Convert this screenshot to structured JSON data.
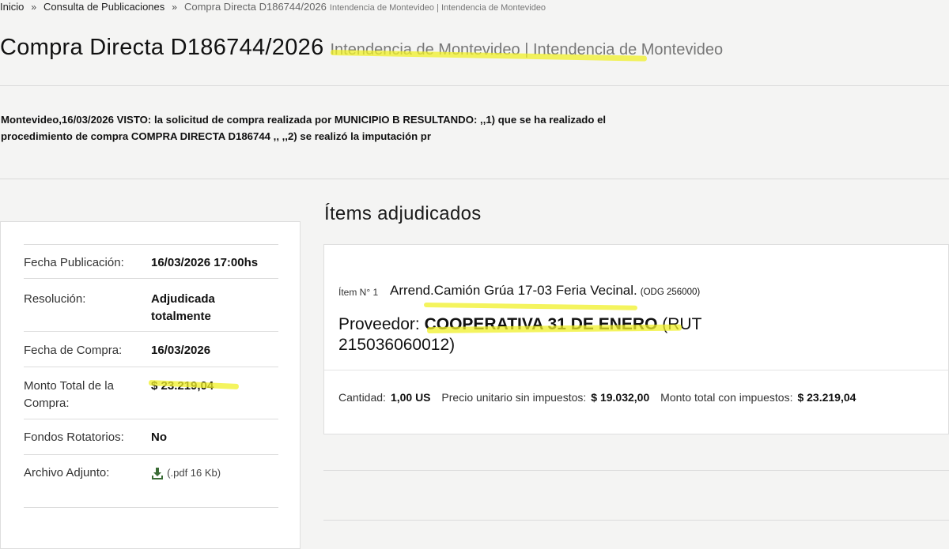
{
  "breadcrumb": {
    "items": [
      "Inicio",
      "Consulta de Publicaciones"
    ],
    "separator": "»",
    "current": "Compra Directa D186744/2026",
    "current_sub": "Intendencia de Montevideo | Intendencia de Montevideo"
  },
  "header": {
    "title": "Compra Directa D186744/2026",
    "subtitle": "Intendencia de Montevideo | Intendencia de Montevideo"
  },
  "description": {
    "line1": "Montevideo,16/03/2026 VISTO: la solicitud de compra realizada por MUNICIPIO B RESULTANDO: ,,1) que se ha realizado el",
    "line2": "procedimiento de compra COMPRA DIRECTA D186744 ,, ,,2) se realizó la imputación pr"
  },
  "details": {
    "fecha_publicacion": {
      "label": "Fecha Publicación:",
      "value": "16/03/2026 17:00hs"
    },
    "resolucion": {
      "label": "Resolución:",
      "value": "Adjudicada totalmente"
    },
    "fecha_compra": {
      "label": "Fecha de Compra:",
      "value": "16/03/2026"
    },
    "monto_total": {
      "label": "Monto Total de la Compra:",
      "value": "$ 23.219,04"
    },
    "fondos_rotatorios": {
      "label": "Fondos Rotatorios:",
      "value": "No"
    },
    "archivo_adjunto": {
      "label": "Archivo Adjunto:",
      "value": "(.pdf 16 Kb)",
      "icon": "download-icon"
    }
  },
  "items_section": {
    "heading": "Ítems adjudicados",
    "items": [
      {
        "number_label": "Ítem N° 1",
        "description": "Arrend.Camión Grúa 17-03 Feria Vecinal.",
        "odg": "(ODG 256000)",
        "supplier_label": "Proveedor:",
        "supplier_name": "COOPERATIVA 31 DE ENERO",
        "supplier_rut": "(RUT 215036060012)",
        "cantidad_label": "Cantidad:",
        "cantidad_value": "1,00 US",
        "precio_label": "Precio unitario sin impuestos:",
        "precio_value": "$ 19.032,00",
        "monto_label": "Monto total con impuestos:",
        "monto_value": "$ 23.219,04"
      }
    ]
  },
  "colors": {
    "background": "#f4f4f3",
    "highlight": "#f0f028",
    "download_icon": "#3a6b35"
  }
}
